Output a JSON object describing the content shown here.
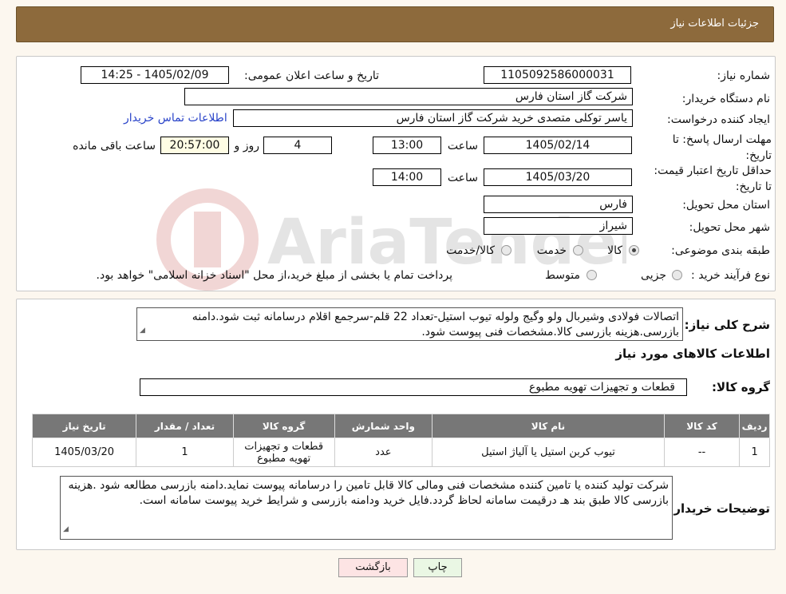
{
  "header": {
    "title": "جزئیات اطلاعات نیاز"
  },
  "need_number": {
    "label": "شماره نیاز:",
    "value": "1105092586000031"
  },
  "announce": {
    "label": "تاریخ و ساعت اعلان عمومی:",
    "value": "1405/02/09 - 14:25"
  },
  "buyer_org": {
    "label": "نام دستگاه خریدار:",
    "value": "شرکت گاز استان فارس"
  },
  "creator": {
    "label": "ایجاد کننده درخواست:",
    "value": "یاسر توکلی متصدی خرید شرکت گاز استان فارس",
    "contact_link": "اطلاعات تماس خریدار"
  },
  "reply_deadline": {
    "label": "مهلت ارسال پاسخ: تا تاریخ:",
    "date": "1405/02/14",
    "time_label": "ساعت",
    "time": "13:00",
    "days": "4",
    "days_label": "روز و",
    "remaining": "20:57:00",
    "remaining_label": "ساعت باقی مانده"
  },
  "price_validity": {
    "label": "حداقل تاریخ اعتبار قیمت: تا تاریخ:",
    "date": "1405/03/20",
    "time_label": "ساعت",
    "time": "14:00"
  },
  "province": {
    "label": "استان محل تحویل:",
    "value": "فارس"
  },
  "city": {
    "label": "شهر محل تحویل:",
    "value": "شیراز"
  },
  "category": {
    "label": "طبقه بندی موضوعی:",
    "options": [
      "کالا",
      "خدمت",
      "کالا/خدمت"
    ]
  },
  "process": {
    "label": "نوع فرآیند خرید :",
    "options": [
      "جزیی",
      "متوسط"
    ],
    "note": "پرداخت تمام یا بخشی از مبلغ خرید،از محل \"اسناد خزانه اسلامی\" خواهد بود."
  },
  "description": {
    "label": "شرح کلی نیاز:",
    "value": "اتصالات فولادی وشیربال ولو وگیج ولوله تیوب استیل-تعداد 22 قلم-سرجمع اقلام درسامانه ثبت شود.دامنه بازرسی.هزینه بازرسی کالا.مشخصات فنی پیوست شود."
  },
  "goods_section": {
    "title": "اطلاعات کالاهای مورد نیاز"
  },
  "goods_group": {
    "label": "گروه کالا:",
    "value": "قطعات و تجهیزات تهویه مطبوع"
  },
  "table": {
    "headers": [
      "ردیف",
      "کد کالا",
      "نام کالا",
      "واحد شمارش",
      "گروه کالا",
      "تعداد / مقدار",
      "تاریخ نیاز"
    ],
    "rows": [
      [
        "1",
        "--",
        "تیوب کربن استیل یا آلیاژ استیل",
        "عدد",
        "قطعات و تجهیزات تهویه مطبوع",
        "1",
        "1405/03/20"
      ]
    ]
  },
  "buyer_notes": {
    "label": "توضیحات خریدار:",
    "value": "شرکت تولید کننده یا تامین کننده مشخصات فنی ومالی کالا قابل تامین را درسامانه پیوست نماید.دامنه بازرسی مطالعه شود .هزینه بازرسی کالا طبق بند هـ درقیمت سامانه لحاظ گردد.فایل خرید ودامنه بازرسی و شرایط خرید پیوست سامانه است."
  },
  "buttons": {
    "print": "چاپ",
    "back": "بازگشت"
  },
  "watermark": {
    "text": "AriaTender.neT"
  }
}
